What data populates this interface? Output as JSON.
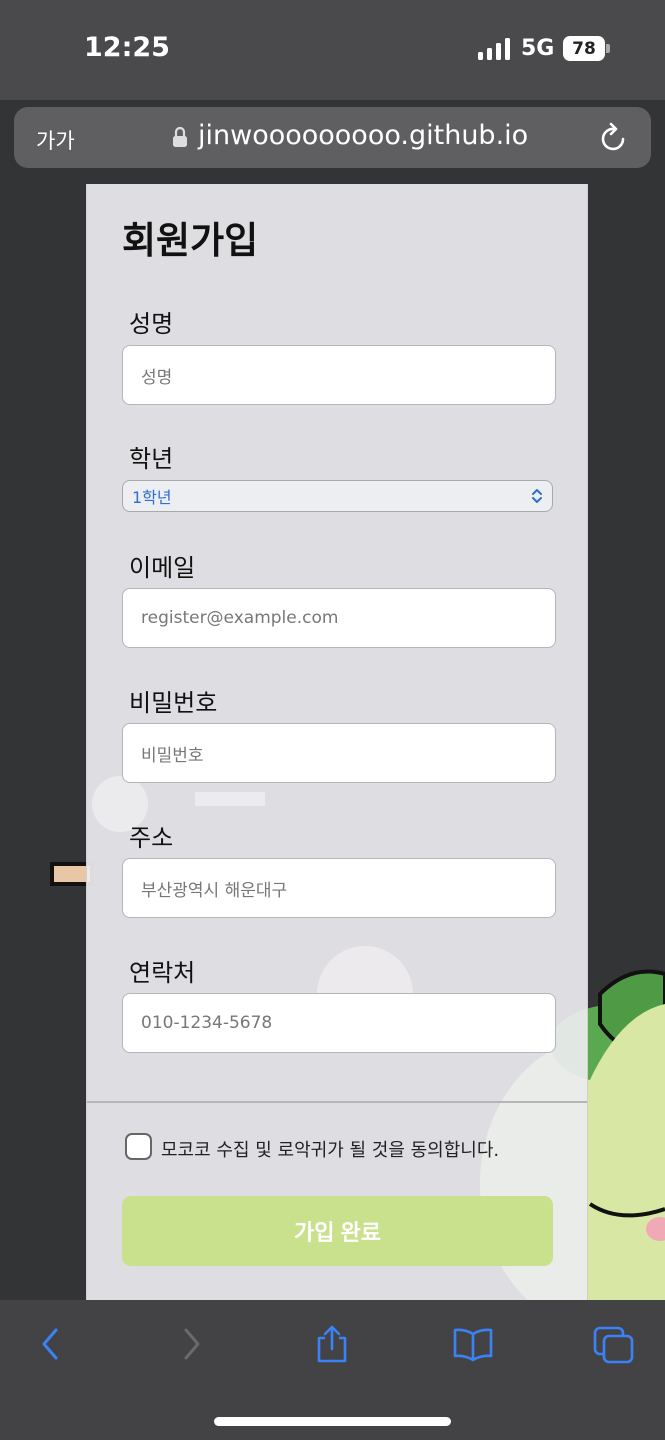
{
  "status_bar": {
    "time": "12:25",
    "network": "5G",
    "battery": "78",
    "icons": [
      "signal-icon",
      "battery-icon"
    ]
  },
  "browser": {
    "text_size_label": "가가",
    "url": "jinwooooooooo.github.io",
    "icons": [
      "lock-icon",
      "reload-icon"
    ]
  },
  "form": {
    "title": "회원가입",
    "fields": {
      "name": {
        "label": "성명",
        "placeholder": "성명"
      },
      "grade": {
        "label": "학년",
        "selected": "1학년"
      },
      "email": {
        "label": "이메일",
        "placeholder": "register@example.com"
      },
      "password": {
        "label": "비밀번호",
        "placeholder": "비밀번호"
      },
      "address": {
        "label": "주소",
        "placeholder": "부산광역시 해운대구"
      },
      "phone": {
        "label": "연락처",
        "placeholder": "010-1234-5678"
      }
    },
    "agree_label": "모코코 수집 및 로악귀가 될 것을 동의합니다.",
    "submit_label": "가입 완료",
    "accent_color": "#c9e08c"
  },
  "toolbar": {
    "icons": [
      "back-icon",
      "forward-icon",
      "share-icon",
      "bookmarks-icon",
      "tabs-icon"
    ],
    "active_color": "#3b82f6"
  }
}
